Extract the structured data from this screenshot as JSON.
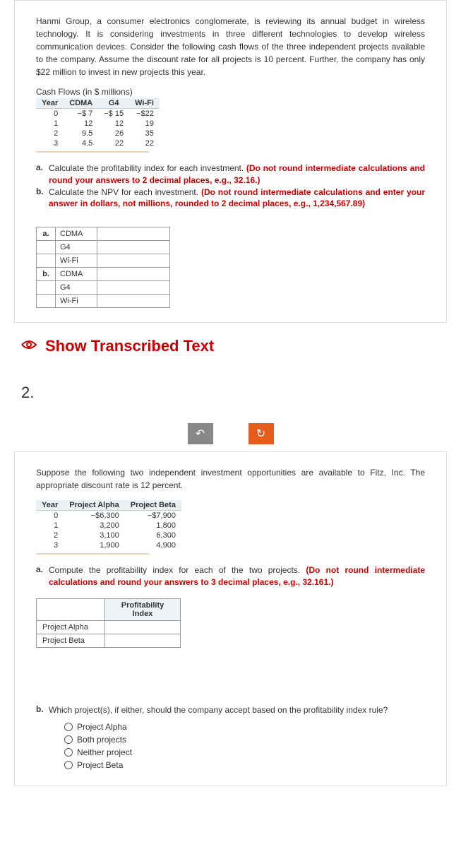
{
  "q1": {
    "intro": "Hanmi Group, a consumer electronics conglomerate, is reviewing its annual budget in wireless technology. It is considering investments in three different technologies to develop wireless communication devices. Consider the following cash flows of the three independent projects available to the company. Assume the discount rate for all projects is 10 percent. Further, the company has only $22 million to invest in new projects this year.",
    "table_title": "Cash Flows (in $ millions)",
    "headers": {
      "year": "Year",
      "cdma": "CDMA",
      "g4": "G4",
      "wifi": "Wi-Fi"
    },
    "rows": [
      {
        "year": "0",
        "cdma": "7",
        "g4": "15",
        "wifi": "22",
        "neg": true
      },
      {
        "year": "1",
        "cdma": "12",
        "g4": "12",
        "wifi": "19"
      },
      {
        "year": "2",
        "cdma": "9.5",
        "g4": "26",
        "wifi": "35"
      },
      {
        "year": "3",
        "cdma": "4.5",
        "g4": "22",
        "wifi": "22"
      }
    ],
    "a_label": "a.",
    "a_text": "Calculate the profitability index for each investment.",
    "a_red": "(Do not round intermediate calculations and round your answers to 2 decimal places, e.g., 32.16.)",
    "b_label": "b.",
    "b_text": "Calculate the NPV for each investment.",
    "b_red": "(Do not round intermediate calculations and enter your answer in dollars, not millions, rounded to 2 decimal places, e.g., 1,234,567.89)",
    "ans_labels": {
      "a": "a.",
      "b": "b.",
      "cdma": "CDMA",
      "g4": "G4",
      "wifi": "Wi-Fi"
    }
  },
  "transcribed": "Show Transcribed Text",
  "number2": "2.",
  "q2": {
    "intro": "Suppose the following two independent investment opportunities are available to Fitz, Inc. The appropriate discount rate is 12 percent.",
    "headers": {
      "year": "Year",
      "alpha": "Project Alpha",
      "beta": "Project Beta"
    },
    "rows": [
      {
        "year": "0",
        "alpha": "−$6,300",
        "beta": "−$7,900"
      },
      {
        "year": "1",
        "alpha": "3,200",
        "beta": "1,800"
      },
      {
        "year": "2",
        "alpha": "3,100",
        "beta": "6,300"
      },
      {
        "year": "3",
        "alpha": "1,900",
        "beta": "4,900"
      }
    ],
    "a_label": "a.",
    "a_text": "Compute the profitability index for each of the two projects.",
    "a_red": "(Do not round intermediate calculations and round your answers to 3 decimal places, e.g., 32.161.)",
    "pi_header": "Profitability Index",
    "pi_rows": {
      "alpha": "Project Alpha",
      "beta": "Project Beta"
    },
    "b_label": "b.",
    "b_text": "Which project(s), if either, should the company accept based on the profitability index rule?",
    "options": [
      "Project Alpha",
      "Both projects",
      "Neither project",
      "Project Beta"
    ]
  }
}
